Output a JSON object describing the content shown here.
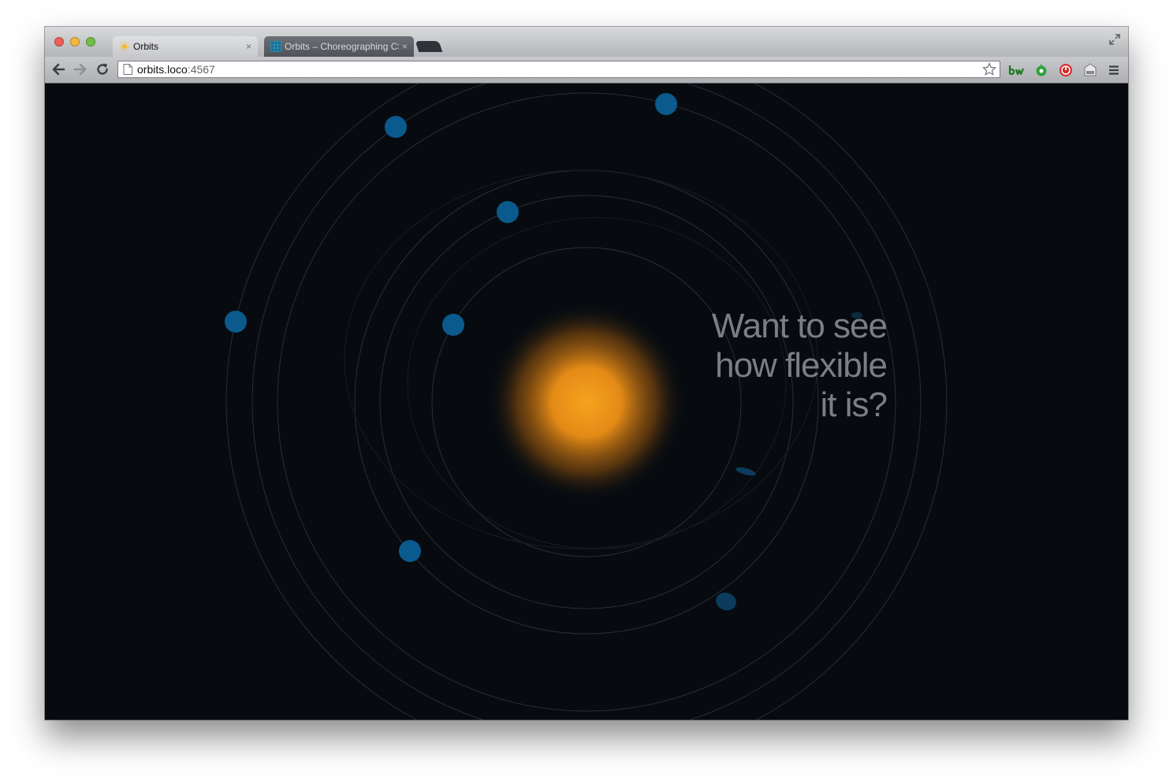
{
  "browser": {
    "tabs": [
      {
        "title": "Orbits",
        "active": true,
        "close_glyph": "×"
      },
      {
        "title": "Orbits – Choreographing CSS",
        "active": false,
        "close_glyph": "×"
      }
    ],
    "url_host": "orbits.loco",
    "url_port": ":4567",
    "icons": [
      "back-arrow-icon",
      "forward-arrow-icon",
      "reload-icon",
      "page-icon",
      "bookmark-star-icon",
      "menu-icon",
      "fullscreen-icon"
    ],
    "extensions": [
      "bw-extension-icon",
      "green-extension-icon",
      "red-extension-icon",
      "tag-extension-icon"
    ]
  },
  "page": {
    "headline": "Want to see how flexible it is?",
    "colors": {
      "background": "#070b10",
      "sun": "#f59c1d",
      "planet": "#0a5a8d",
      "orbit": "#2a2e34",
      "headline": "#7b7f84"
    }
  }
}
